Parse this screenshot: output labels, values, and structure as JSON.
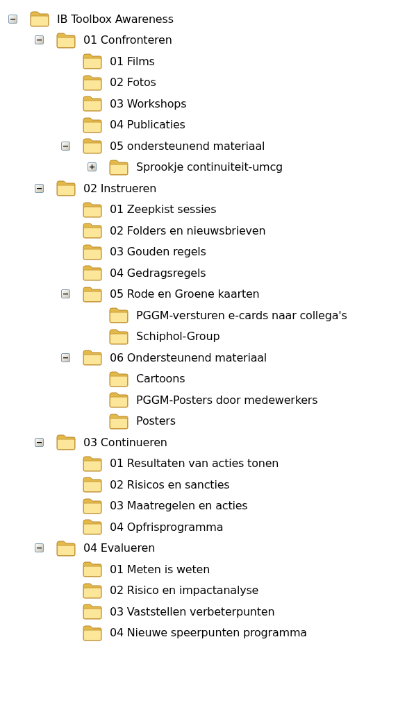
{
  "tree": [
    {
      "label": "IB Toolbox Awareness",
      "expanded": true,
      "children": [
        {
          "label": "01 Confronteren",
          "expanded": true,
          "children": [
            {
              "label": "01 Films"
            },
            {
              "label": "02 Fotos"
            },
            {
              "label": "03 Workshops"
            },
            {
              "label": "04 Publicaties"
            },
            {
              "label": "05 ondersteunend materiaal",
              "expanded": true,
              "children": [
                {
                  "label": "Sprookje continuiteit-umcg",
                  "expanded": false
                }
              ]
            }
          ]
        },
        {
          "label": "02 Instrueren",
          "expanded": true,
          "children": [
            {
              "label": "01 Zeepkist sessies"
            },
            {
              "label": "02 Folders en nieuwsbrieven"
            },
            {
              "label": "03 Gouden regels"
            },
            {
              "label": "04 Gedragsregels"
            },
            {
              "label": "05 Rode en Groene kaarten",
              "expanded": true,
              "children": [
                {
                  "label": "PGGM-versturen e-cards naar collega's"
                },
                {
                  "label": "Schiphol-Group"
                }
              ]
            },
            {
              "label": "06 Ondersteunend materiaal",
              "expanded": true,
              "children": [
                {
                  "label": "Cartoons"
                },
                {
                  "label": "PGGM-Posters door medewerkers"
                },
                {
                  "label": "Posters"
                }
              ]
            }
          ]
        },
        {
          "label": "03 Continueren",
          "expanded": true,
          "children": [
            {
              "label": "01 Resultaten van acties tonen"
            },
            {
              "label": "02 Risicos en sancties"
            },
            {
              "label": "03 Maatregelen en acties"
            },
            {
              "label": "04 Opfrisprogramma"
            }
          ]
        },
        {
          "label": "04 Evalueren",
          "expanded": true,
          "children": [
            {
              "label": "01 Meten is weten"
            },
            {
              "label": "02 Risico en impactanalyse"
            },
            {
              "label": "03 Vaststellen verbeterpunten"
            },
            {
              "label": "04 Nieuwe speerpunten programma"
            }
          ]
        }
      ]
    }
  ]
}
